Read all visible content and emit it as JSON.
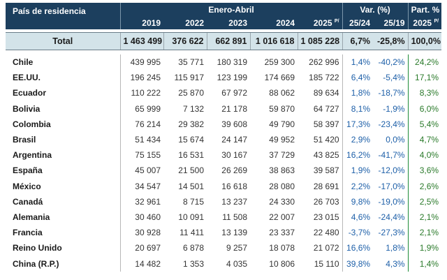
{
  "header": {
    "country_col": "País de residencia",
    "period": "Enero-Abril",
    "var_label": "Var. (%)",
    "part_label": "Part. %",
    "years": [
      "2019",
      "2022",
      "2023",
      "2024",
      "2025"
    ],
    "year_2025_sup": "P/",
    "var_cols": [
      "25/24",
      "25/19"
    ],
    "part_col": "2025",
    "part_col_sup": "P/"
  },
  "total": {
    "name": "Total",
    "values": [
      "1 463 499",
      "376 622",
      "662 891",
      "1 016 618",
      "1 085 228"
    ],
    "var": [
      "6,7%",
      "-25,8%"
    ],
    "part": "100,0%"
  },
  "rows": [
    {
      "name": "Chile",
      "values": [
        "439 995",
        "35 771",
        "180 319",
        "259 300",
        "262 996"
      ],
      "var": [
        "1,4%",
        "-40,2%"
      ],
      "part": "24,2%"
    },
    {
      "name": "EE.UU.",
      "values": [
        "196 245",
        "115 917",
        "123 199",
        "174 669",
        "185 722"
      ],
      "var": [
        "6,4%",
        "-5,4%"
      ],
      "part": "17,1%"
    },
    {
      "name": "Ecuador",
      "values": [
        "110 222",
        "25 870",
        "67 972",
        "88 062",
        "89 634"
      ],
      "var": [
        "1,8%",
        "-18,7%"
      ],
      "part": "8,3%"
    },
    {
      "name": "Bolivia",
      "values": [
        "65 999",
        "7 132",
        "21 178",
        "59 870",
        "64 727"
      ],
      "var": [
        "8,1%",
        "-1,9%"
      ],
      "part": "6,0%"
    },
    {
      "name": "Colombia",
      "values": [
        "76 214",
        "29 382",
        "39 608",
        "49 790",
        "58 397"
      ],
      "var": [
        "17,3%",
        "-23,4%"
      ],
      "part": "5,4%"
    },
    {
      "name": "Brasil",
      "values": [
        "51 434",
        "15 674",
        "24 147",
        "49 952",
        "51 420"
      ],
      "var": [
        "2,9%",
        "0,0%"
      ],
      "part": "4,7%"
    },
    {
      "name": "Argentina",
      "values": [
        "75 155",
        "16 531",
        "30 167",
        "37 729",
        "43 825"
      ],
      "var": [
        "16,2%",
        "-41,7%"
      ],
      "part": "4,0%"
    },
    {
      "name": "España",
      "values": [
        "45 007",
        "21 500",
        "26 269",
        "38 863",
        "39 587"
      ],
      "var": [
        "1,9%",
        "-12,0%"
      ],
      "part": "3,6%"
    },
    {
      "name": "México",
      "values": [
        "34 547",
        "14 501",
        "16 618",
        "28 080",
        "28 691"
      ],
      "var": [
        "2,2%",
        "-17,0%"
      ],
      "part": "2,6%"
    },
    {
      "name": "Canadá",
      "values": [
        "32 961",
        "8 715",
        "13 237",
        "24 330",
        "26 703"
      ],
      "var": [
        "9,8%",
        "-19,0%"
      ],
      "part": "2,5%"
    },
    {
      "name": "Alemania",
      "values": [
        "30 460",
        "10 091",
        "11 508",
        "22 007",
        "23 015"
      ],
      "var": [
        "4,6%",
        "-24,4%"
      ],
      "part": "2,1%"
    },
    {
      "name": "Francia",
      "values": [
        "30 928",
        "11 411",
        "13 139",
        "23 337",
        "22 480"
      ],
      "var": [
        "-3,7%",
        "-27,3%"
      ],
      "part": "2,1%"
    },
    {
      "name": "Reino Unido",
      "values": [
        "20 697",
        "6 878",
        "9 257",
        "18 078",
        "21 072"
      ],
      "var": [
        "16,6%",
        "1,8%"
      ],
      "part": "1,9%"
    },
    {
      "name": "China (R.P.)",
      "values": [
        "14 482",
        "1 353",
        "4 035",
        "10 806",
        "15 110"
      ],
      "var": [
        "39,8%",
        "4,3%"
      ],
      "part": "1,4%"
    }
  ]
}
